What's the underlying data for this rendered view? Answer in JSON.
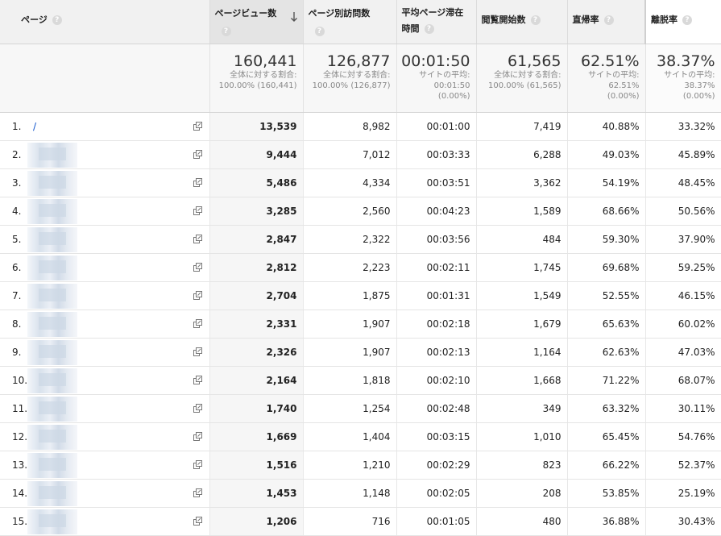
{
  "columns": [
    {
      "label": "ページ"
    },
    {
      "label": "ページビュー数"
    },
    {
      "label": "ページ別訪問数"
    },
    {
      "label": "平均ページ滞在時間"
    },
    {
      "label": "閲覧開始数"
    },
    {
      "label": "直帰率"
    },
    {
      "label": "離脱率"
    }
  ],
  "help_glyph": "?",
  "summary": {
    "pageviews": {
      "value": "160,441",
      "line1": "全体に対する割合:",
      "line2": "100.00% (160,441)"
    },
    "unique": {
      "value": "126,877",
      "line1": "全体に対する割合:",
      "line2": "100.00% (126,877)"
    },
    "avg_time": {
      "value": "00:01:50",
      "line1": "サイトの平均:",
      "line2": "00:01:50",
      "line3": "(0.00%)"
    },
    "entrances": {
      "value": "61,565",
      "line1": "全体に対する割合:",
      "line2": "100.00% (61,565)"
    },
    "bounce": {
      "value": "62.51%",
      "line1": "サイトの平均:",
      "line2": "62.51%",
      "line3": "(0.00%)"
    },
    "exit": {
      "value": "38.37%",
      "line1": "サイトの平均:",
      "line2": "38.37%",
      "line3": "(0.00%)"
    }
  },
  "rows": [
    {
      "idx": "1.",
      "page": "/",
      "pv": "13,539",
      "upv": "8,982",
      "time": "00:01:00",
      "ent": "7,419",
      "bounce": "40.88%",
      "exit": "33.32%"
    },
    {
      "idx": "2.",
      "page": "",
      "pv": "9,444",
      "upv": "7,012",
      "time": "00:03:33",
      "ent": "6,288",
      "bounce": "49.03%",
      "exit": "45.89%"
    },
    {
      "idx": "3.",
      "page": "",
      "pv": "5,486",
      "upv": "4,334",
      "time": "00:03:51",
      "ent": "3,362",
      "bounce": "54.19%",
      "exit": "48.45%"
    },
    {
      "idx": "4.",
      "page": "",
      "pv": "3,285",
      "upv": "2,560",
      "time": "00:04:23",
      "ent": "1,589",
      "bounce": "68.66%",
      "exit": "50.56%"
    },
    {
      "idx": "5.",
      "page": "",
      "pv": "2,847",
      "upv": "2,322",
      "time": "00:03:56",
      "ent": "484",
      "bounce": "59.30%",
      "exit": "37.90%"
    },
    {
      "idx": "6.",
      "page": "",
      "pv": "2,812",
      "upv": "2,223",
      "time": "00:02:11",
      "ent": "1,745",
      "bounce": "69.68%",
      "exit": "59.25%"
    },
    {
      "idx": "7.",
      "page": "",
      "pv": "2,704",
      "upv": "1,875",
      "time": "00:01:31",
      "ent": "1,549",
      "bounce": "52.55%",
      "exit": "46.15%"
    },
    {
      "idx": "8.",
      "page": "",
      "pv": "2,331",
      "upv": "1,907",
      "time": "00:02:18",
      "ent": "1,679",
      "bounce": "65.63%",
      "exit": "60.02%"
    },
    {
      "idx": "9.",
      "page": "",
      "pv": "2,326",
      "upv": "1,907",
      "time": "00:02:13",
      "ent": "1,164",
      "bounce": "62.63%",
      "exit": "47.03%"
    },
    {
      "idx": "10.",
      "page": "",
      "pv": "2,164",
      "upv": "1,818",
      "time": "00:02:10",
      "ent": "1,668",
      "bounce": "71.22%",
      "exit": "68.07%"
    },
    {
      "idx": "11.",
      "page": "",
      "pv": "1,740",
      "upv": "1,254",
      "time": "00:02:48",
      "ent": "349",
      "bounce": "63.32%",
      "exit": "30.11%"
    },
    {
      "idx": "12.",
      "page": "",
      "pv": "1,669",
      "upv": "1,404",
      "time": "00:03:15",
      "ent": "1,010",
      "bounce": "65.45%",
      "exit": "54.76%"
    },
    {
      "idx": "13.",
      "page": "",
      "pv": "1,516",
      "upv": "1,210",
      "time": "00:02:29",
      "ent": "823",
      "bounce": "66.22%",
      "exit": "52.37%"
    },
    {
      "idx": "14.",
      "page": "",
      "pv": "1,453",
      "upv": "1,148",
      "time": "00:02:05",
      "ent": "208",
      "bounce": "53.85%",
      "exit": "25.19%"
    },
    {
      "idx": "15.",
      "page": "",
      "pv": "1,206",
      "upv": "716",
      "time": "00:01:05",
      "ent": "480",
      "bounce": "36.88%",
      "exit": "30.43%"
    }
  ]
}
